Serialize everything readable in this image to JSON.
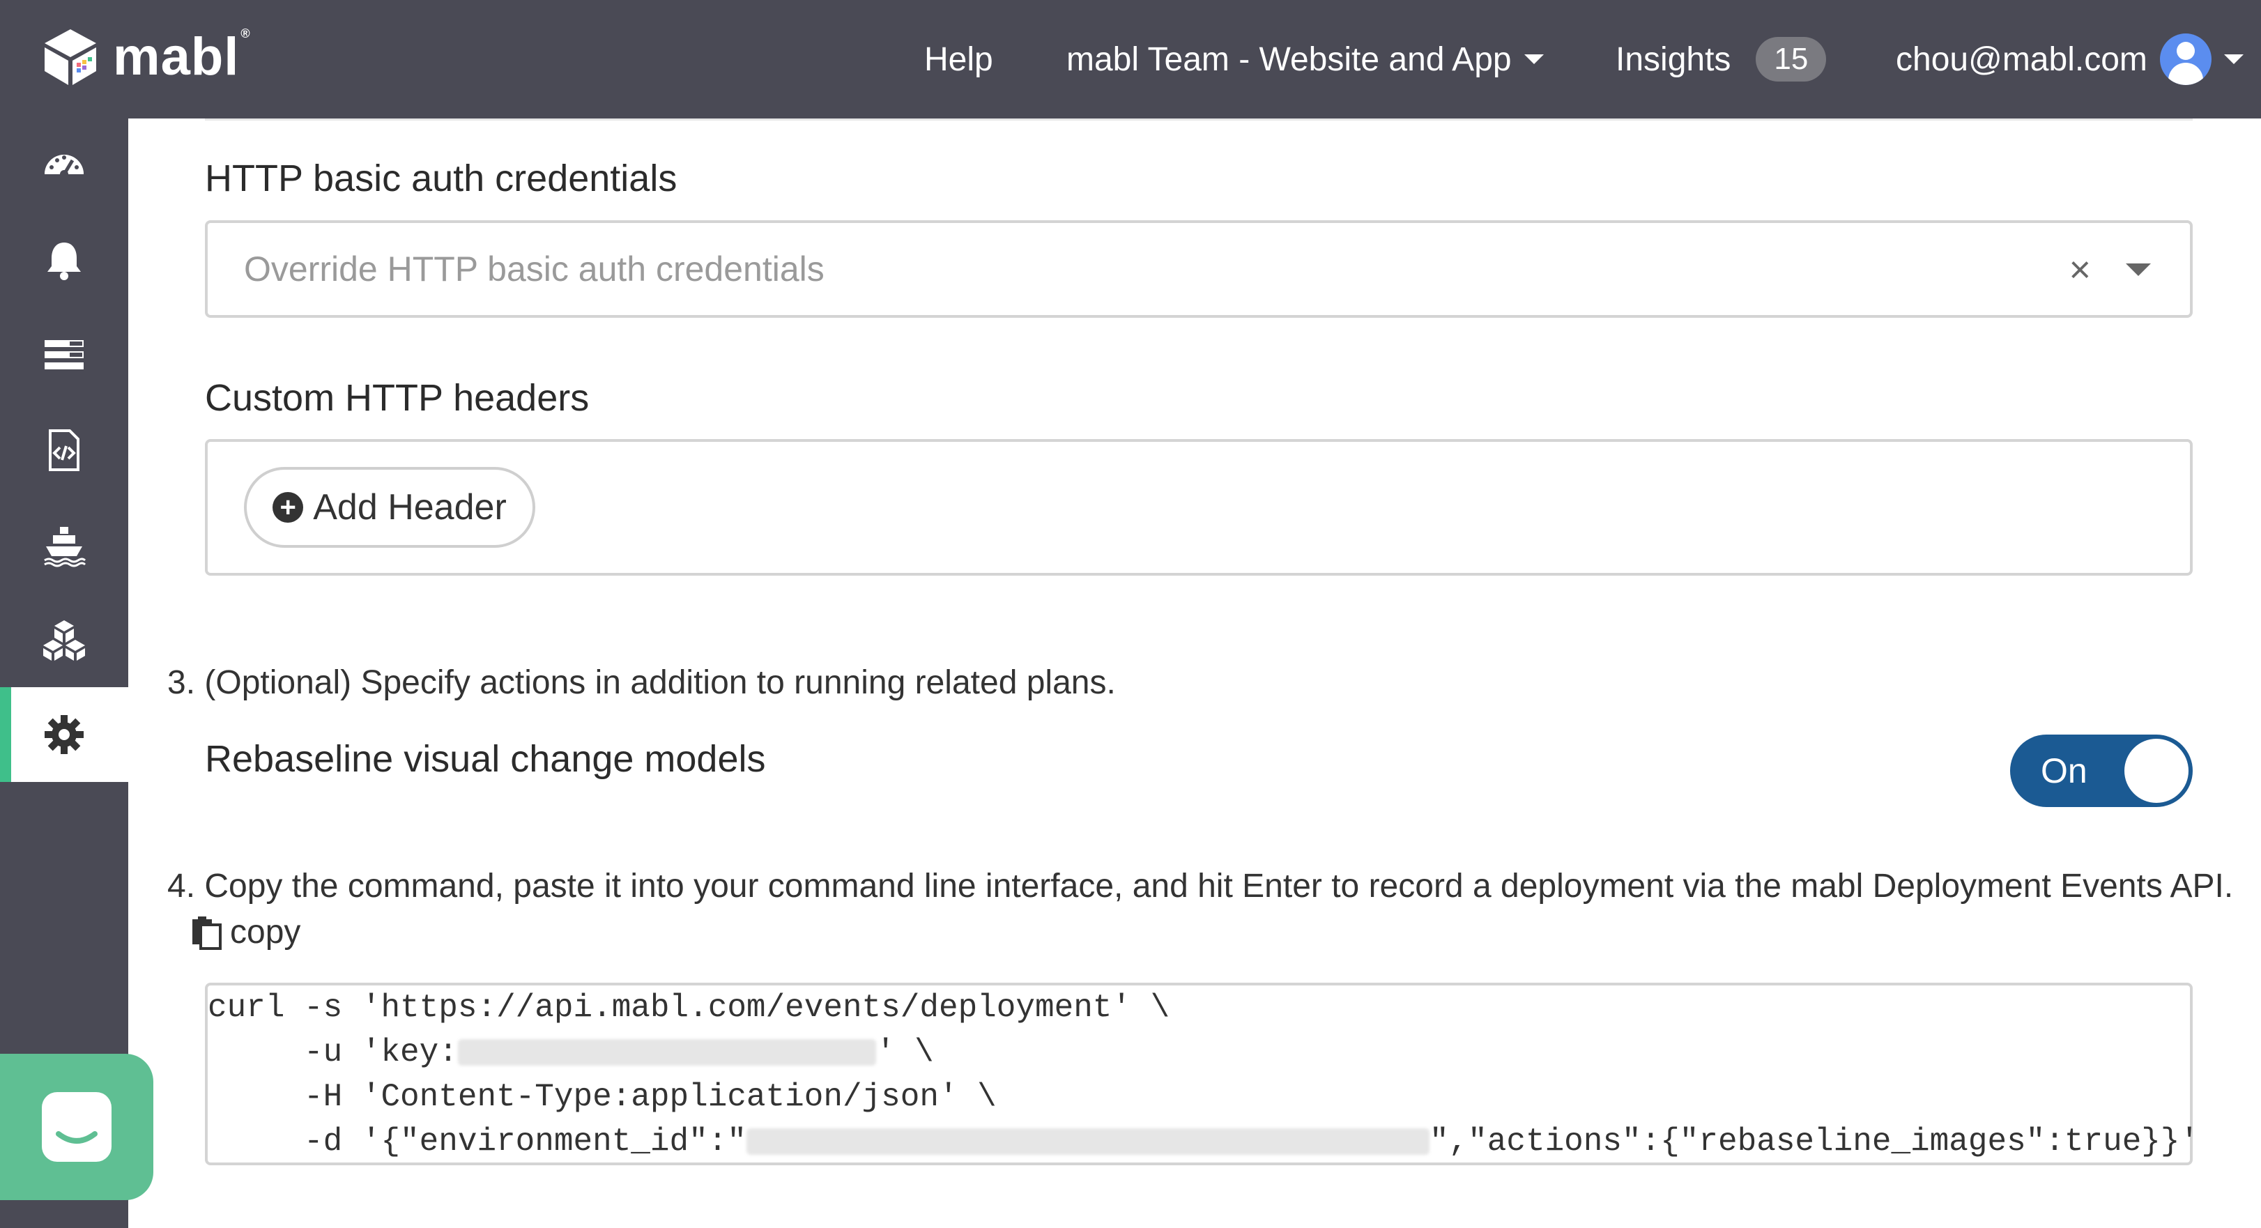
{
  "brand": {
    "name": "mabl",
    "reg": "®"
  },
  "header": {
    "help": "Help",
    "team": "mabl Team - Website and App",
    "insights": "Insights",
    "insights_count": "15",
    "user_email": "chou@mabl.com"
  },
  "sidebar": {
    "items": [
      {
        "icon": "dashboard-icon"
      },
      {
        "icon": "bell-icon"
      },
      {
        "icon": "list-icon"
      },
      {
        "icon": "code-file-icon"
      },
      {
        "icon": "ship-icon"
      },
      {
        "icon": "cubes-icon"
      },
      {
        "icon": "gear-icon",
        "active": true
      }
    ]
  },
  "auth": {
    "label": "HTTP basic auth credentials",
    "placeholder": "Override HTTP basic auth credentials",
    "clear": "×"
  },
  "headers": {
    "label": "Custom HTTP headers",
    "add_button": "Add Header",
    "add_symbol": "+"
  },
  "step3": {
    "text": "3. (Optional) Specify actions in addition to running related plans.",
    "option_label": "Rebaseline visual change models",
    "toggle_label": "On",
    "toggle_on": true
  },
  "step4": {
    "text": "4. Copy the command, paste it into your command line interface, and hit Enter to record a deployment via the mabl Deployment Events API.",
    "copy_label": "copy"
  },
  "code": {
    "line1": "curl -s 'https://api.mabl.com/events/deployment' \\",
    "line2_a": "     -u 'key:",
    "line2_b": "' \\",
    "line3": "     -H 'Content-Type:application/json' \\",
    "line4_a": "     -d '{\"environment_id\":\"",
    "line4_b": "\",\"actions\":{\"rebaseline_images\":true}}'"
  },
  "colors": {
    "topbar": "#4a4a55",
    "accent_green": "#3fbf8a",
    "toggle_blue": "#1b5a93",
    "chat_green": "#5fbf93"
  }
}
